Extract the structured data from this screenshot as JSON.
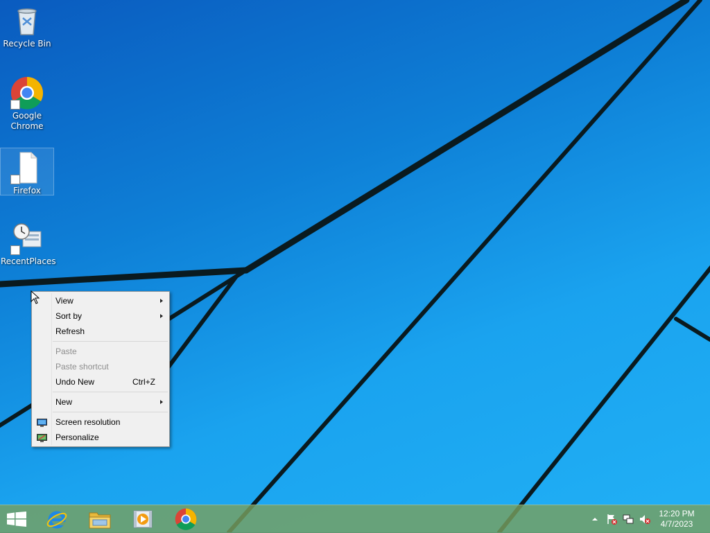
{
  "desktop": {
    "icons": [
      {
        "label": "Recycle Bin",
        "icon": "recycle-bin-icon"
      },
      {
        "label": "Google Chrome",
        "icon": "chrome-icon"
      },
      {
        "label": "Firefox",
        "icon": "blank-file-icon"
      },
      {
        "label": "RecentPlaces",
        "icon": "recent-places-icon"
      }
    ]
  },
  "context_menu": {
    "items": [
      {
        "label": "View",
        "submenu": true
      },
      {
        "label": "Sort by",
        "submenu": true
      },
      {
        "label": "Refresh"
      },
      {
        "label": "Paste",
        "disabled": true
      },
      {
        "label": "Paste shortcut",
        "disabled": true
      },
      {
        "label": "Undo New",
        "shortcut": "Ctrl+Z"
      },
      {
        "label": "New",
        "submenu": true
      },
      {
        "label": "Screen resolution",
        "icon": "screen-resolution-icon"
      },
      {
        "label": "Personalize",
        "icon": "personalize-icon"
      }
    ]
  },
  "taskbar": {
    "pinned": [
      {
        "name": "Internet Explorer",
        "icon": "internet-explorer-icon"
      },
      {
        "name": "File Explorer",
        "icon": "file-explorer-icon"
      },
      {
        "name": "Windows Media Player",
        "icon": "media-player-icon"
      },
      {
        "name": "Google Chrome",
        "icon": "chrome-icon"
      }
    ],
    "tray": {
      "icons": [
        "show-hidden-icons-chevron",
        "action-center-flag-icon",
        "network-icon",
        "volume-muted-icon"
      ]
    },
    "clock": {
      "time": "12:20 PM",
      "date": "4/7/2023"
    }
  },
  "colors": {
    "wallpaper_light": "#21b0f5",
    "wallpaper_dark": "#0a5bbf",
    "taskbar": "#78a05f",
    "menu_bg": "#f0f0f0"
  }
}
